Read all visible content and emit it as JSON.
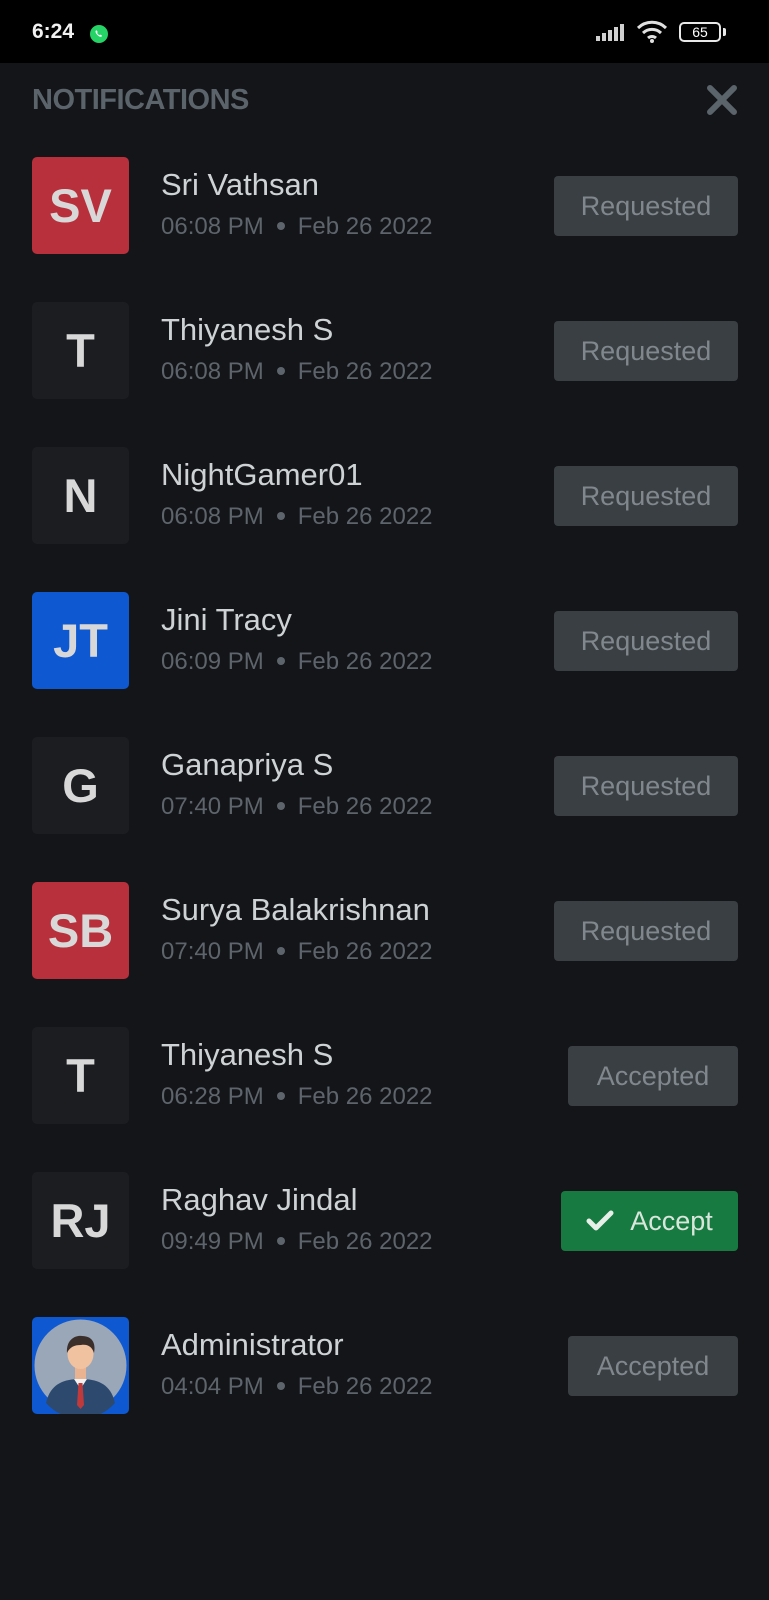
{
  "status_bar": {
    "time": "6:24",
    "battery": "65"
  },
  "header": {
    "title": "NOTIFICATIONS"
  },
  "notifications": [
    {
      "avatar_text": "SV",
      "avatar_color": "#b8303c",
      "name": "Sri Vathsan",
      "time": "06:08 PM",
      "date": "Feb 26 2022",
      "action": "Requested",
      "action_type": "requested"
    },
    {
      "avatar_text": "T",
      "avatar_color": "#1b1d21",
      "name": "Thiyanesh S",
      "time": "06:08 PM",
      "date": "Feb 26 2022",
      "action": "Requested",
      "action_type": "requested"
    },
    {
      "avatar_text": "N",
      "avatar_color": "#1b1d21",
      "name": "NightGamer01",
      "time": "06:08 PM",
      "date": "Feb 26 2022",
      "action": "Requested",
      "action_type": "requested"
    },
    {
      "avatar_text": "JT",
      "avatar_color": "#0e59d1",
      "name": "Jini Tracy",
      "time": "06:09 PM",
      "date": "Feb 26 2022",
      "action": "Requested",
      "action_type": "requested"
    },
    {
      "avatar_text": "G",
      "avatar_color": "#1b1d21",
      "name": "Ganapriya S",
      "time": "07:40 PM",
      "date": "Feb 26 2022",
      "action": "Requested",
      "action_type": "requested"
    },
    {
      "avatar_text": "SB",
      "avatar_color": "#b8303c",
      "name": "Surya Balakrishnan",
      "time": "07:40 PM",
      "date": "Feb 26 2022",
      "action": "Requested",
      "action_type": "requested"
    },
    {
      "avatar_text": "T",
      "avatar_color": "#1b1d21",
      "name": "Thiyanesh S",
      "time": "06:28 PM",
      "date": "Feb 26 2022",
      "action": "Accepted",
      "action_type": "accepted"
    },
    {
      "avatar_text": "RJ",
      "avatar_color": "#1b1d21",
      "name": "Raghav Jindal",
      "time": "09:49 PM",
      "date": "Feb 26 2022",
      "action": "Accept",
      "action_type": "accept"
    },
    {
      "avatar_text": "",
      "avatar_color": "#0e59d1",
      "avatar_icon": "user-portrait-icon",
      "name": "Administrator",
      "time": "04:04 PM",
      "date": "Feb 26 2022",
      "action": "Accepted",
      "action_type": "accepted"
    }
  ]
}
